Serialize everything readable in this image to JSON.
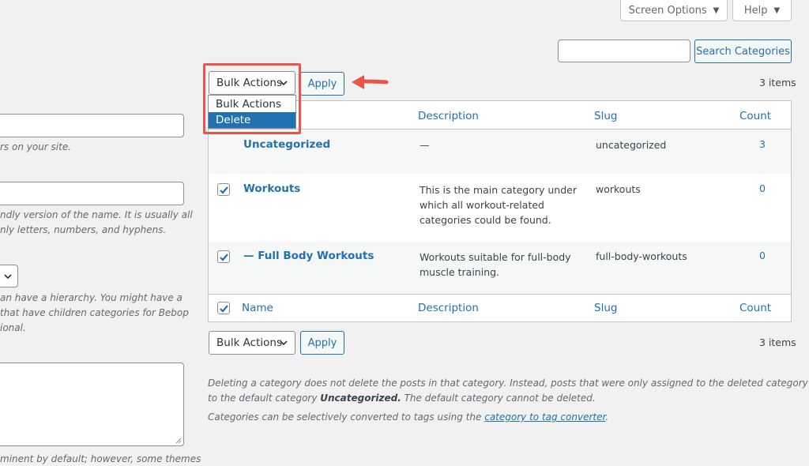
{
  "screen_tabs": {
    "screen_options": "Screen Options",
    "help": "Help"
  },
  "search": {
    "value": "",
    "button_label": "Search Categories"
  },
  "bulk_top": {
    "selected": "Bulk Actions",
    "apply_label": "Apply",
    "items_count": "3 items",
    "options": [
      "Bulk Actions",
      "Delete"
    ],
    "highlighted_option": "Delete"
  },
  "bulk_bottom": {
    "selected": "Bulk Actions",
    "apply_label": "Apply",
    "items_count": "3 items"
  },
  "left_form": {
    "name_help": "rs on your site.",
    "slug_help_1": "ndly version of the name. It is usually all",
    "slug_help_2": "nly letters, numbers, and hyphens.",
    "parent_help_1": "an have a hierarchy. You might have a",
    "parent_help_2": "that have children categories for Bebop",
    "parent_help_3": "ional.",
    "description_help": "minent by default; however, some themes"
  },
  "table": {
    "headers": {
      "name": "Name",
      "description": "Description",
      "slug": "Slug",
      "count": "Count"
    },
    "rows": [
      {
        "name": "Uncategorized",
        "description": [
          "—"
        ],
        "slug": "uncategorized",
        "count": "3",
        "checked": false
      },
      {
        "name": "Workouts",
        "description": [
          "This is the main category under",
          "which all workout-related",
          "categories could be found."
        ],
        "slug": "workouts",
        "count": "0",
        "checked": true
      },
      {
        "name": "— Full Body Workouts",
        "description": [
          "Workouts suitable for full-body",
          "muscle training."
        ],
        "slug": "full-body-workouts",
        "count": "0",
        "checked": true
      }
    ]
  },
  "footnotes": {
    "line1": "Deleting a category does not delete the posts in that category. Instead, posts that were only assigned to the deleted category are set",
    "line2_pre": "to the default category ",
    "line2_bold": "Uncategorized.",
    "line2_post": " The default category cannot be deleted.",
    "line3_pre": "Categories can be selectively converted to tags using the ",
    "line3_link": "category to tag converter",
    "line3_post": "."
  },
  "colors": {
    "accent": "#2271b1",
    "highlight_red": "#e8564b",
    "background": "#f1f1f1"
  }
}
